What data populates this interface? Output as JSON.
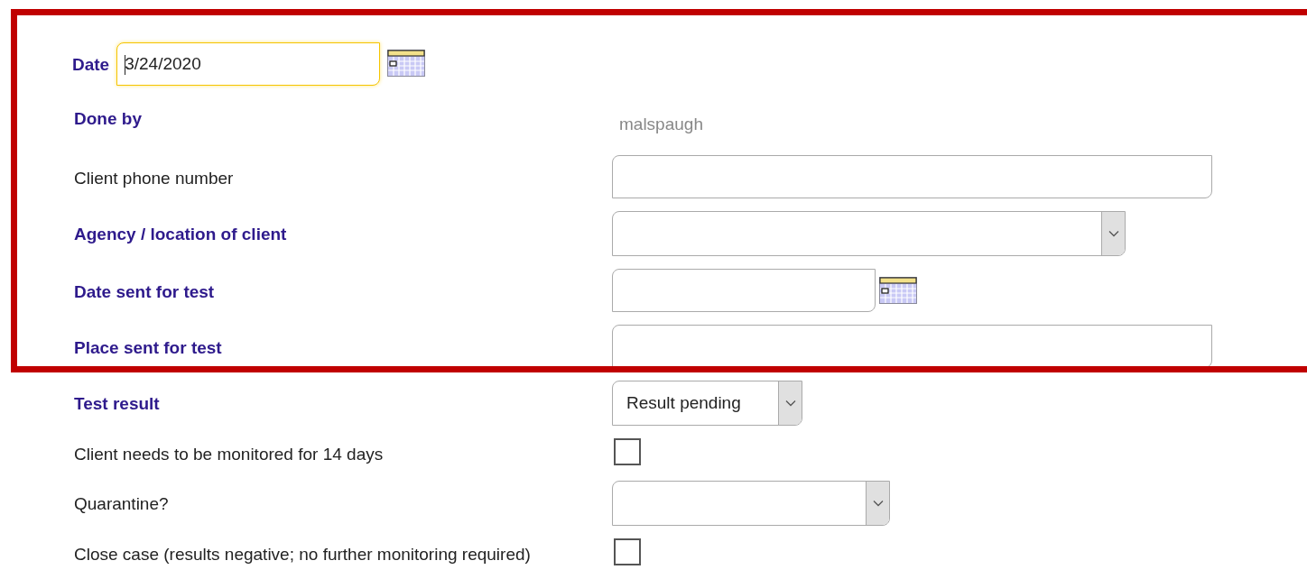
{
  "date": {
    "label": "Date",
    "value": "3/24/2020",
    "focused": true
  },
  "fields": [
    {
      "kind": "readonly",
      "label": "Done by",
      "required": true,
      "value": "malspaugh"
    },
    {
      "kind": "text",
      "label": "Client phone number",
      "required": false
    },
    {
      "kind": "select",
      "label": "Agency / location of client",
      "required": true
    },
    {
      "kind": "date",
      "label": "Date sent for test",
      "required": true
    },
    {
      "kind": "text",
      "label": "Place sent for test",
      "required": true
    },
    {
      "kind": "picker",
      "label": "Test result",
      "required": true,
      "value": "Result pending"
    },
    {
      "kind": "checkbox",
      "label": "Client needs to be monitored for 14 days",
      "required": false,
      "checked": false
    },
    {
      "kind": "shortselect",
      "label": "Quarantine?",
      "required": false
    },
    {
      "kind": "checkbox",
      "label": "Close case (results negative; no further monitoring required)",
      "required": false,
      "checked": false
    }
  ]
}
